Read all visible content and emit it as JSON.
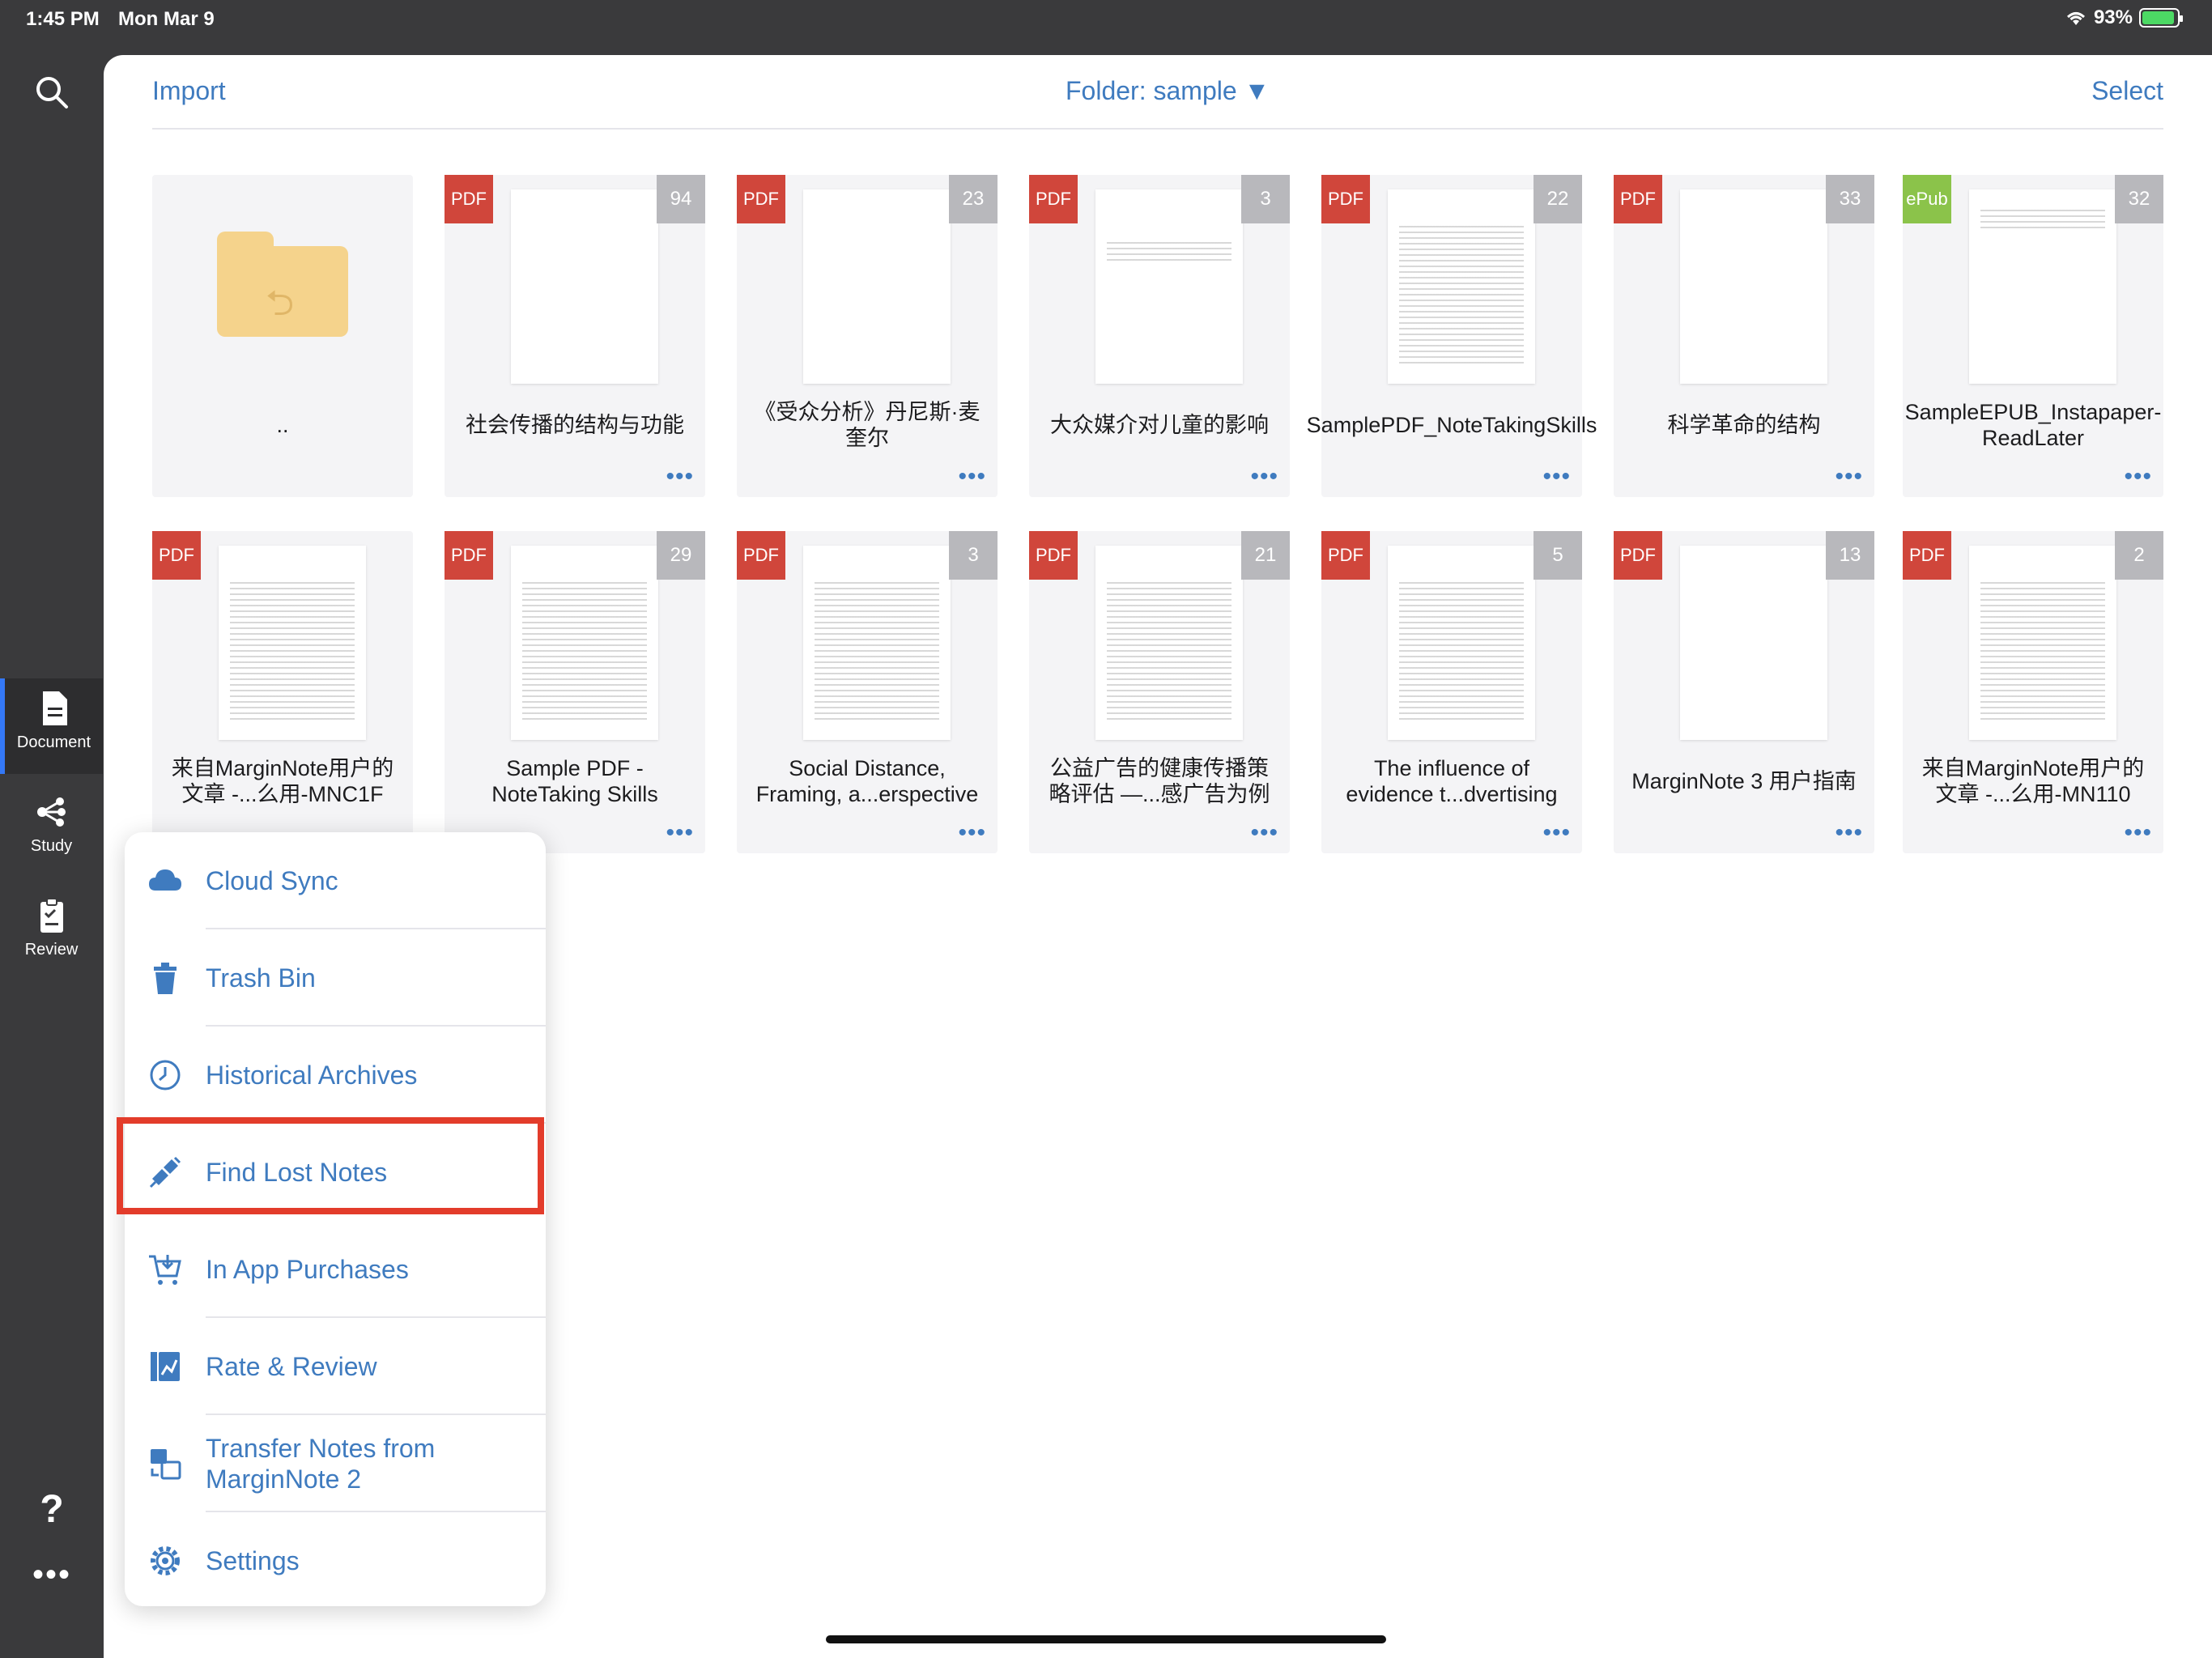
{
  "status_bar": {
    "time": "1:45 PM",
    "date": "Mon Mar 9",
    "battery": "93%"
  },
  "rail": {
    "items": [
      {
        "label": "Document",
        "icon": "document-icon"
      },
      {
        "label": "Study",
        "icon": "study-icon"
      },
      {
        "label": "Review",
        "icon": "review-icon"
      }
    ],
    "help": "?",
    "more": "•••"
  },
  "topbar": {
    "import": "Import",
    "folder": "Folder: sample ▼",
    "select": "Select"
  },
  "documents": [
    {
      "title": "..",
      "type": "folder"
    },
    {
      "title": "社会传播的结构与功能",
      "type": "PDF",
      "pages": "94"
    },
    {
      "title": "《受众分析》丹尼斯·麦奎尔",
      "type": "PDF",
      "pages": "23"
    },
    {
      "title": "大众媒介对儿童的影响",
      "type": "PDF",
      "pages": "3"
    },
    {
      "title": "SamplePDF_NoteTakingSkills",
      "type": "PDF",
      "pages": "22"
    },
    {
      "title": "科学革命的结构",
      "type": "PDF",
      "pages": "33"
    },
    {
      "title": "SampleEPUB_Instapaper-ReadLater",
      "type": "ePub",
      "pages": "32"
    },
    {
      "title": "来自MarginNote用户的文章 -...么用-MNC1F",
      "type": "PDF",
      "pages": ""
    },
    {
      "title": "Sample PDF - NoteTaking Skills",
      "type": "PDF",
      "pages": "29"
    },
    {
      "title": "Social Distance, Framing, a...erspective",
      "type": "PDF",
      "pages": "3"
    },
    {
      "title": "公益广告的健康传播策略评估 —...感广告为例",
      "type": "PDF",
      "pages": "21"
    },
    {
      "title": "The influence of evidence t...dvertising",
      "type": "PDF",
      "pages": "5"
    },
    {
      "title": "MarginNote 3 用户指南",
      "type": "PDF",
      "pages": "13"
    },
    {
      "title": "来自MarginNote用户的文章 -...么用-MN110",
      "type": "PDF",
      "pages": "2"
    }
  ],
  "menu": [
    {
      "label": "Cloud Sync",
      "icon": "cloud-icon"
    },
    {
      "label": "Trash Bin",
      "icon": "trash-icon"
    },
    {
      "label": "Historical Archives",
      "icon": "history-icon"
    },
    {
      "label": "Find Lost Notes",
      "icon": "find-lost-notes-icon"
    },
    {
      "label": "In App Purchases",
      "icon": "cart-icon"
    },
    {
      "label": "Rate & Review",
      "icon": "rate-icon"
    },
    {
      "label": "Transfer Notes from MarginNote 2",
      "icon": "transfer-icon"
    },
    {
      "label": "Settings",
      "icon": "gear-icon"
    }
  ],
  "colors": {
    "accent": "#3f7bbf",
    "pdf_badge": "#d0463b",
    "epub_badge": "#8bc34a",
    "highlight": "#e33c2b"
  }
}
